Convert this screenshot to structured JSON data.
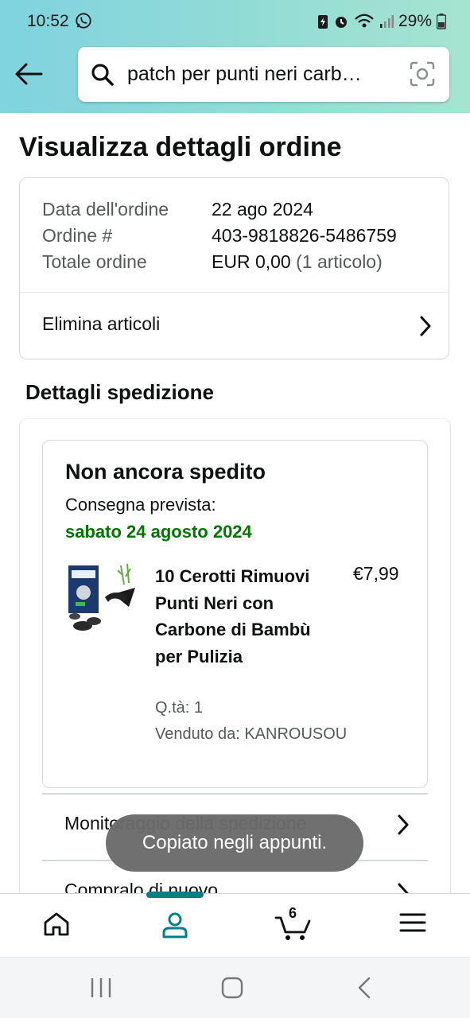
{
  "status_bar": {
    "time": "10:52",
    "battery": "29%"
  },
  "search": {
    "query": "patch per punti neri carb…"
  },
  "page": {
    "title": "Visualizza dettagli ordine"
  },
  "order_summary": {
    "date_label": "Data dell'ordine",
    "date_value": "22 ago 2024",
    "number_label": "Ordine #",
    "number_value": "403-9818826-5486759",
    "total_label": "Totale ordine",
    "total_value": "EUR 0,00",
    "total_items": "(1 articolo)",
    "delete_items_label": "Elimina articoli"
  },
  "shipment": {
    "section_title": "Dettagli spedizione",
    "status": "Non ancora spedito",
    "delivery_label": "Consegna prevista:",
    "delivery_date": "sabato 24 agosto 2024",
    "item": {
      "name": "10 Cerotti Rimuovi Punti Neri con Carbone di Bambù per Pulizia",
      "price": "€7,99",
      "quantity": "Q.tà: 1",
      "seller": "Venduto da: KANROUSOU"
    },
    "track_label": "Monitoraggio della spedizione",
    "buy_again_label": "Compralo di nuovo"
  },
  "toast": {
    "message": "Copiato negli appunti."
  },
  "tabbar": {
    "cart_count": "6",
    "active_tab": "account"
  },
  "colors": {
    "header_gradient_start": "#7fd3df",
    "header_gradient_end": "#a6e4d0",
    "delivery_green": "#007600",
    "active_teal": "#077e87"
  },
  "icons": [
    "whatsapp-icon",
    "back-arrow-icon",
    "search-icon",
    "camera-scan-icon",
    "chevron-right-icon",
    "home-icon",
    "account-icon",
    "cart-icon",
    "menu-icon"
  ]
}
